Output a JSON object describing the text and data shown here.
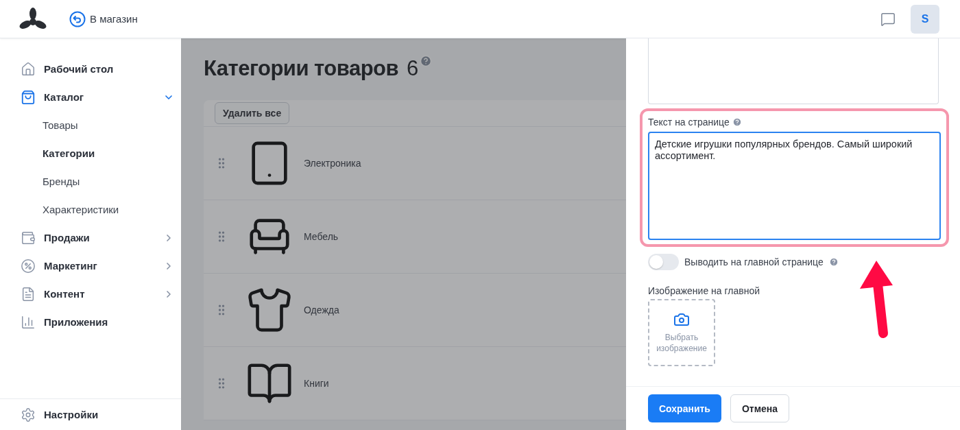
{
  "header": {
    "back_link": "В магазин",
    "avatar": "S"
  },
  "sidebar": {
    "items": [
      {
        "label": "Рабочий стол",
        "selected": false
      },
      {
        "label": "Каталог",
        "selected": true,
        "expanded": true,
        "children": [
          {
            "label": "Товары",
            "selected": false
          },
          {
            "label": "Категории",
            "selected": true
          },
          {
            "label": "Бренды",
            "selected": false
          },
          {
            "label": "Характеристики",
            "selected": false
          }
        ]
      },
      {
        "label": "Продажи",
        "selected": false,
        "expanded": false
      },
      {
        "label": "Маркетинг",
        "selected": false,
        "expanded": false
      },
      {
        "label": "Контент",
        "selected": false,
        "expanded": false
      },
      {
        "label": "Приложения",
        "selected": false
      }
    ],
    "settings": "Настройки"
  },
  "page": {
    "title": "Категории товаров",
    "count": "6",
    "delete_all_button": "Удалить все",
    "categories": [
      {
        "name": "Электроника"
      },
      {
        "name": "Мебель"
      },
      {
        "name": "Одежда"
      },
      {
        "name": "Книги"
      }
    ]
  },
  "drawer": {
    "page_text": {
      "label": "Текст на странице",
      "value": "Детские игрушки популярных брендов. Самый широкий ассортимент.",
      "focused": true
    },
    "show_on_main": {
      "label": "Выводить на главной странице",
      "on": false
    },
    "main_image": {
      "label": "Изображение на главной",
      "button": "Выбрать изображение"
    },
    "save_button": "Сохранить",
    "cancel_button": "Отмена"
  }
}
